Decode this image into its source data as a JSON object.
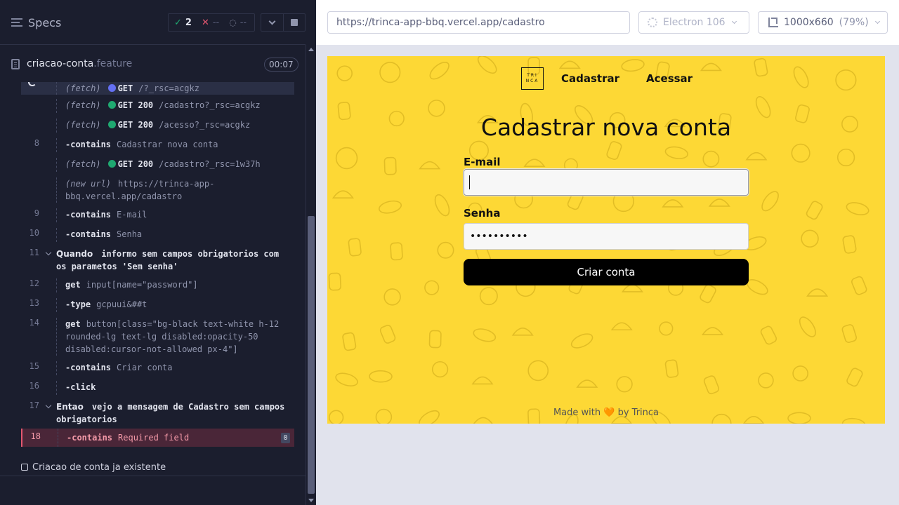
{
  "reporter": {
    "specs_label": "Specs",
    "stats": {
      "passed": "2",
      "failed": "--",
      "pending": "--"
    },
    "spec_file": {
      "name": "criacao-conta",
      "ext": ".feature",
      "duration": "00:07"
    },
    "commands": [
      {
        "num": "",
        "type": "fetch",
        "paren": "(fetch)",
        "kw": "GET",
        "msg": "/?_rsc=acgkz",
        "dot": "blue",
        "state": "active"
      },
      {
        "num": "",
        "type": "fetch",
        "paren": "(fetch)",
        "kw": "GET 200",
        "msg": "/cadastro?_rsc=acgkz",
        "dot": "green"
      },
      {
        "num": "",
        "type": "fetch",
        "paren": "(fetch)",
        "kw": "GET 200",
        "msg": "/acesso?_rsc=acgkz",
        "dot": "green"
      },
      {
        "num": "8",
        "type": "cmd",
        "kw": "contains",
        "msg": "Cadastrar nova conta"
      },
      {
        "num": "",
        "type": "fetch",
        "paren": "(fetch)",
        "kw": "GET 200",
        "msg": "/cadastro?_rsc=1w37h",
        "dot": "green"
      },
      {
        "num": "",
        "type": "newurl",
        "paren": "(new url)",
        "msg": "https://trinca-app-bbq.vercel.app/cadastro"
      },
      {
        "num": "9",
        "type": "cmd",
        "kw": "contains",
        "msg": "E-mail"
      },
      {
        "num": "10",
        "type": "cmd",
        "kw": "contains",
        "msg": "Senha"
      },
      {
        "num": "11",
        "type": "step",
        "kw": "Quando",
        "msg": "informo sem campos obrigatorios com os parametos 'Sem senha'"
      },
      {
        "num": "12",
        "type": "cmd",
        "kw": "get",
        "msg": "input[name=\"password\"]"
      },
      {
        "num": "13",
        "type": "cmd",
        "kw": "type",
        "msg": "gcpuui&##t"
      },
      {
        "num": "14",
        "type": "cmd",
        "kw": "get",
        "msg": "button[class=\"bg-black text-white h-12 rounded-lg text-lg disabled:opacity-50 disabled:cursor-not-allowed px-4\"]"
      },
      {
        "num": "15",
        "type": "cmd",
        "kw": "contains",
        "msg": "Criar conta"
      },
      {
        "num": "16",
        "type": "cmd",
        "kw": "click",
        "msg": ""
      },
      {
        "num": "17",
        "type": "step",
        "kw": "Entao",
        "msg": "vejo a mensagem de Cadastro sem campos obrigatorios"
      },
      {
        "num": "18",
        "type": "cmd",
        "kw": "contains",
        "msg": "Required field",
        "state": "failed",
        "badge": "0"
      }
    ],
    "next_test": "Criacao de conta ja existente"
  },
  "aut_header": {
    "url": "https://trinca-app-bbq.vercel.app/cadastro",
    "browser": "Electron 106",
    "viewport": "1000x660",
    "zoom": "(79%)"
  },
  "app": {
    "logo_lines": [
      "TRI",
      "NCA"
    ],
    "nav": [
      "Cadastrar",
      "Acessar"
    ],
    "title": "Cadastrar nova conta",
    "email_label": "E-mail",
    "email_value": "",
    "password_label": "Senha",
    "password_value": "••••••••••",
    "submit_label": "Criar conta",
    "footer_before": "Made with",
    "footer_heart": "🧡",
    "footer_after": "by Trinca"
  },
  "colors": {
    "reporter_bg": "#1b1e2e",
    "app_bg": "#fdd835",
    "pass": "#1fa971",
    "fail": "#e45770",
    "running": "#6470f3"
  }
}
